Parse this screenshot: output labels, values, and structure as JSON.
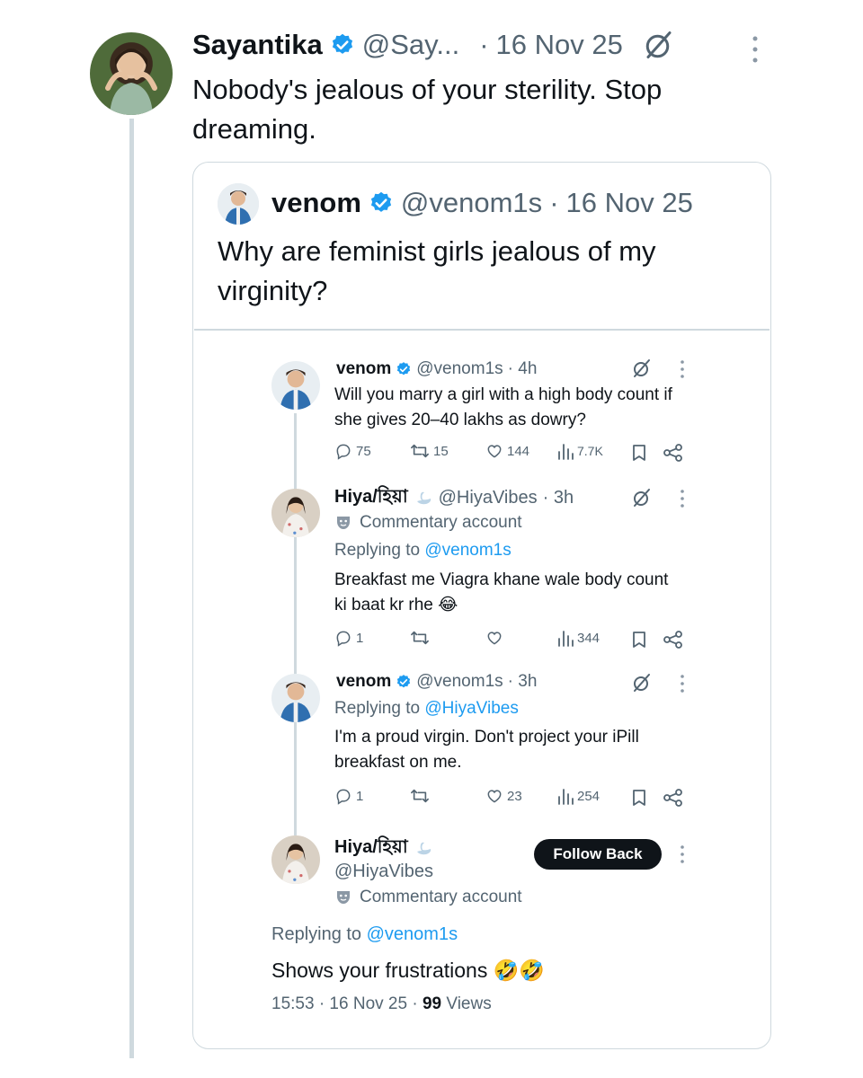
{
  "main_post": {
    "name": "Sayantika",
    "handle": "@Say...",
    "dot": "·",
    "date": "16 Nov 25",
    "text": "Nobody's jealous of your sterility. Stop dreaming."
  },
  "quoted_post": {
    "name": "venom",
    "handle": "@venom1s",
    "dot": "·",
    "date": "16 Nov 25",
    "text": "Why are feminist girls jealous of my virginity?"
  },
  "nested_thread": {
    "post1": {
      "name": "venom",
      "handle": "@venom1s",
      "time": "· 4h",
      "text": "Will you marry a girl with a high body count if she gives 20–40 lakhs as dowry?",
      "replies": "75",
      "reposts": "15",
      "likes": "144",
      "views": "7.7K"
    },
    "post2": {
      "name": "Hiya/হিয়া",
      "handle": "@HiyaVibes",
      "time": "· 3h",
      "label": "Commentary account",
      "replying_prefix": "Replying to",
      "replying_to": "@venom1s",
      "text": "Breakfast me Viagra khane wale body count ki baat kr rhe 😂",
      "replies": "1",
      "reposts": "",
      "likes": "",
      "views": "344"
    },
    "post3": {
      "name": "venom",
      "handle": "@venom1s",
      "time": "· 3h",
      "replying_prefix": "Replying to",
      "replying_to": "@HiyaVibes",
      "text": "I'm a proud virgin. Don't project your iPill breakfast on me.",
      "replies": "1",
      "reposts": "",
      "likes": "23",
      "views": "254"
    },
    "post4": {
      "name": "Hiya/হিয়া",
      "handle": "@HiyaVibes",
      "follow_label": "Follow Back",
      "label": "Commentary account",
      "replying_prefix": "Replying to",
      "replying_to": "@venom1s",
      "text": "Shows your frustrations 🤣🤣",
      "timestamp": "15:53 · 16 Nov 25 ·",
      "views_count": "99",
      "views_label": "Views"
    }
  },
  "colors": {
    "accent": "#1d9bf0",
    "verified": "#1d9bf0",
    "text": "#0f1419",
    "muted": "#536471",
    "border": "#cfd9de"
  },
  "icons": [
    "verified-badge-icon",
    "grok-icon",
    "more-icon",
    "reply-icon",
    "repost-icon",
    "like-icon",
    "views-icon",
    "bookmark-icon",
    "share-icon",
    "theater-mask-icon",
    "swan-icon"
  ]
}
